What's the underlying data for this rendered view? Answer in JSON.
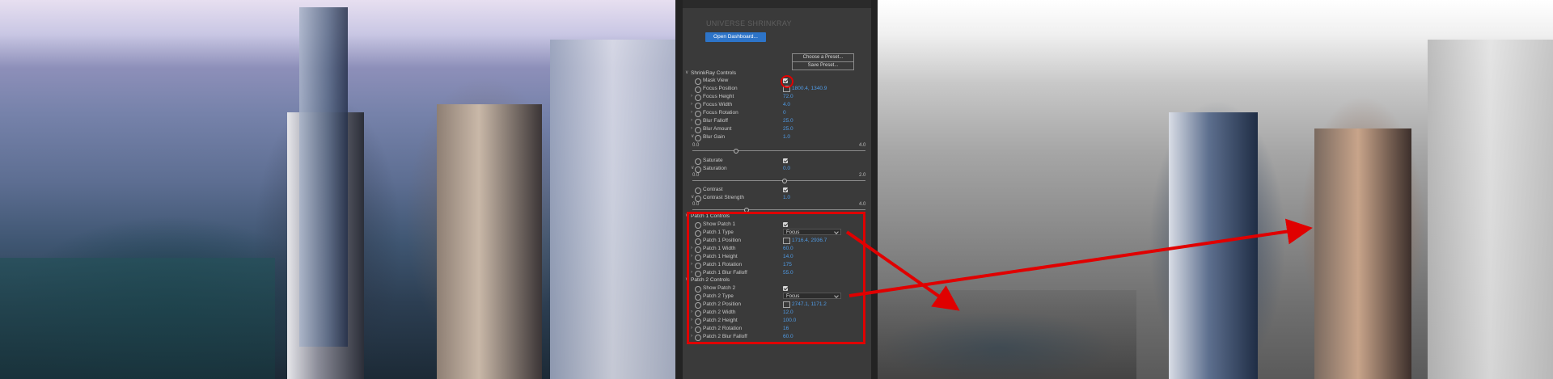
{
  "panel": {
    "header_text": "",
    "brand": "UNIVERSE SHRINKRAY",
    "open_dashboard": "Open Dashboard...",
    "choose_preset": "Choose a Preset...",
    "save_preset": "Save Preset...",
    "shrinkray_group": "ShrinkRay Controls",
    "rows": [
      {
        "label": "Mask View",
        "value": ""
      },
      {
        "label": "Focus Position",
        "value": "1800.4, 1340.9"
      },
      {
        "label": "Focus Height",
        "value": "72.0"
      },
      {
        "label": "Focus Width",
        "value": "4.0"
      },
      {
        "label": "Focus Rotation",
        "value": "0"
      },
      {
        "label": "Blur Falloff",
        "value": "25.0"
      },
      {
        "label": "Blur Amount",
        "value": "25.0"
      },
      {
        "label": "Blur Gain",
        "value": "1.0"
      }
    ],
    "blur_gain_min": "0.0",
    "blur_gain_max": "4.0",
    "saturate_label": "Saturate",
    "saturation_label": "Saturation",
    "saturation_value": "0.0",
    "saturation_min": "0.0",
    "saturation_max": "2.0",
    "contrast_label": "Contrast",
    "contrast_strength_label": "Contrast Strength",
    "contrast_strength_value": "1.0",
    "contrast_min": "0.0",
    "contrast_max": "4.0",
    "patch1": {
      "group": "Patch 1 Controls",
      "show": "Show Patch 1",
      "type_label": "Patch 1 Type",
      "type_value": "Focus",
      "position_label": "Patch 1 Position",
      "position_value": "1716.4, 2936.7",
      "width_label": "Patch 1 Width",
      "width_value": "60.0",
      "height_label": "Patch 1 Height",
      "height_value": "14.0",
      "rotation_label": "Patch 1 Rotation",
      "rotation_value": "175",
      "falloff_label": "Patch 1 Blur Falloff",
      "falloff_value": "55.0"
    },
    "patch2": {
      "group": "Patch 2 Controls",
      "show": "Show Patch 2",
      "type_label": "Patch 2 Type",
      "type_value": "Focus",
      "position_label": "Patch 2 Position",
      "position_value": "2747.1, 1171.2",
      "width_label": "Patch 2 Width",
      "width_value": "12.0",
      "height_label": "Patch 2 Height",
      "height_value": "100.0",
      "rotation_label": "Patch 2 Rotation",
      "rotation_value": "16",
      "falloff_label": "Patch 2 Blur Falloff",
      "falloff_value": "60.0"
    }
  },
  "colors": {
    "accent": "#4f9be6",
    "annotation": "#e00000",
    "panel_bg": "#3a3a3a"
  }
}
